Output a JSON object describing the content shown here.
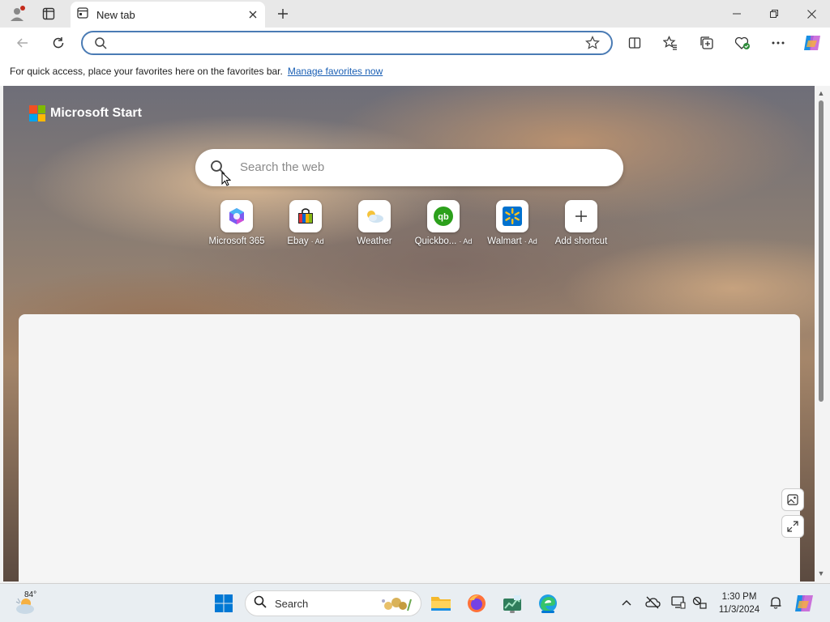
{
  "browser": {
    "tab": {
      "title": "New tab"
    },
    "address": {
      "value": "",
      "placeholder": ""
    },
    "favorites_bar": {
      "text": "For quick access, place your favorites here on the favorites bar.",
      "link": "Manage favorites now"
    }
  },
  "page": {
    "brand": "Microsoft Start",
    "search_placeholder": "Search the web",
    "shortcuts": [
      {
        "label": "Microsoft 365",
        "ad": ""
      },
      {
        "label": "Ebay",
        "ad": "· Ad"
      },
      {
        "label": "Weather",
        "ad": ""
      },
      {
        "label": "Quickbo...",
        "ad": "· Ad"
      },
      {
        "label": "Walmart",
        "ad": "· Ad"
      },
      {
        "label": "Add shortcut",
        "ad": ""
      }
    ]
  },
  "taskbar": {
    "weather_temp": "84°",
    "search_label": "Search",
    "time": "1:30 PM",
    "date": "11/3/2024"
  },
  "colors": {
    "accent": "#0078d4",
    "address_border": "#4a7bb4"
  }
}
